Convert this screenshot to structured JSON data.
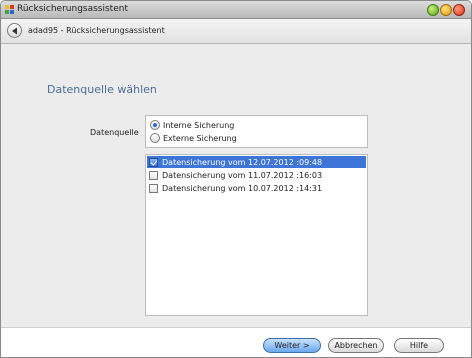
{
  "window": {
    "title": "Rücksicherungsassistent"
  },
  "nav": {
    "breadcrumb": "adad95 - Rücksicherungsassistent"
  },
  "page": {
    "heading": "Datenquelle wählen",
    "source_label": "Datenquelle"
  },
  "source_options": [
    {
      "label": "Interne Sicherung",
      "selected": true
    },
    {
      "label": "Externe Sicherung",
      "selected": false
    }
  ],
  "backups": [
    {
      "label": "Datensicherung vom 12.07.2012 :09:48",
      "checked": true,
      "highlighted": true
    },
    {
      "label": "Datensicherung vom 11.07.2012 :16:03",
      "checked": false,
      "highlighted": false
    },
    {
      "label": "Datensicherung vom 10.07.2012 :14:31",
      "checked": false,
      "highlighted": false
    }
  ],
  "buttons": {
    "next": "Weiter >",
    "cancel": "Abbrechen",
    "help": "Hilfe"
  },
  "colors": {
    "heading": "#4b6e9e",
    "selection": "#3d74d8"
  }
}
